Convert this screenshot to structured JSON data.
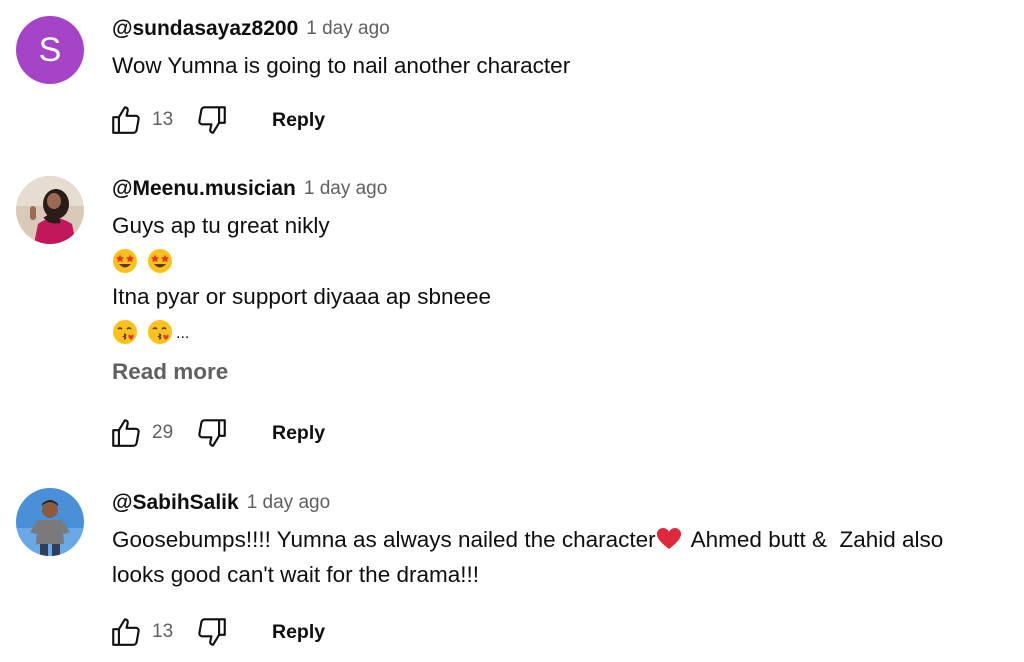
{
  "comments": [
    {
      "avatar_letter": "S",
      "avatar_color": "#a544c7",
      "author": "@sundasayaz8200",
      "time": "1 day ago",
      "lines": [
        "Wow Yumna is going to nail another character"
      ],
      "likes": "13",
      "reply_label": "Reply"
    },
    {
      "author": "@Meenu.musician",
      "time": "1 day ago",
      "line1": "Guys ap tu great nikly",
      "emoji_row1": [
        "star-struck",
        "star-struck"
      ],
      "line2": "Itna pyar or support diyaaa ap sbneee",
      "emoji_row2": [
        "kissing-face",
        "kissing-face"
      ],
      "truncation": "...",
      "read_more": "Read more",
      "likes": "29",
      "reply_label": "Reply"
    },
    {
      "author": "@SabihSalik",
      "time": "1 day ago",
      "line1_part1": "Goosebumps!!!! Yumna as always nailed the character",
      "line1_part2": " Ahmed butt &  Zahid also",
      "line2": "looks good can't wait for the drama!!!",
      "likes": "13",
      "reply_label": "Reply"
    }
  ],
  "icons": {
    "like": "thumbs-up-icon",
    "dislike": "thumbs-down-icon",
    "heart": "red-heart-emoji"
  },
  "colors": {
    "text_primary": "#0f0f0f",
    "text_secondary": "#606060",
    "heart_red": "#e0283c"
  }
}
